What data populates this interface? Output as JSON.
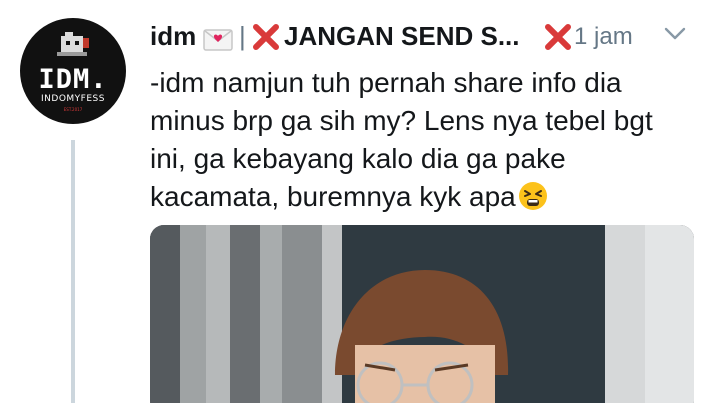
{
  "avatar": {
    "logo_text": "IDM.",
    "sub_text": "INDOMYFESS",
    "tiny_text": "EST.2017"
  },
  "tweet": {
    "display_name": "idm",
    "separator": "|",
    "handle_text": "JANGAN SEND S...",
    "timestamp": "1 jam",
    "body_lines": [
      "-idm namjun tuh pernah share info dia",
      "minus brp ga sih my? Lens nya tebel bgt",
      "ini, ga kebayang kalo dia ga pake",
      "kacamata, buremnya kyk apa"
    ]
  },
  "icons": {
    "letter": "love-letter-icon",
    "cross": "cross-mark-icon",
    "caret": "chevron-down-icon",
    "emoji": "tired-face-icon"
  },
  "colors": {
    "cross_red": "#d93a3a",
    "secondary_text": "#657786",
    "thread_line": "#ccd6dd"
  }
}
